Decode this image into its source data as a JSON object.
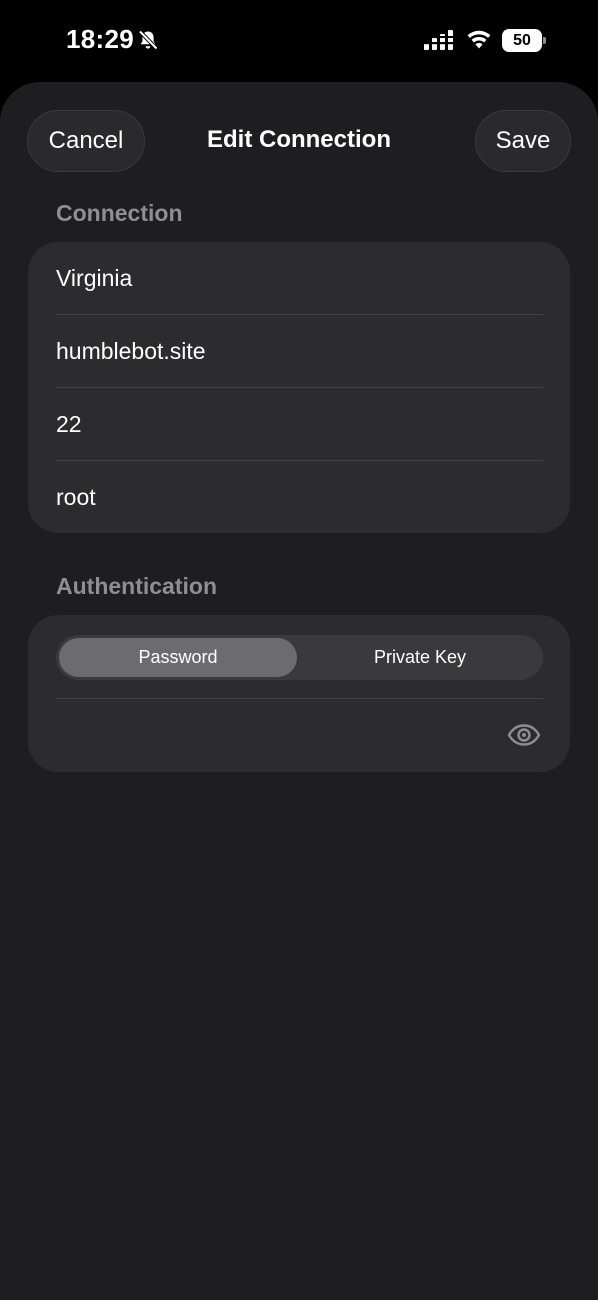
{
  "status_bar": {
    "time": "18:29",
    "battery": "50",
    "icons": [
      "bell-slash-icon",
      "cellular-signal-icon",
      "wifi-icon",
      "battery-icon"
    ]
  },
  "nav": {
    "cancel_label": "Cancel",
    "title": "Edit Connection",
    "save_label": "Save"
  },
  "connection": {
    "header": "Connection",
    "fields": {
      "name": "Virginia",
      "host": "humblebot.site",
      "port": "22",
      "username": "root"
    }
  },
  "authentication": {
    "header": "Authentication",
    "segments": [
      "Password",
      "Private Key"
    ],
    "selected": "Password",
    "password_value": "",
    "reveal_icon": "eye-icon"
  },
  "colors": {
    "background": "#000000",
    "sheet": "#1e1e20",
    "card": "#2c2c2e",
    "secondary_text": "#8e8e93",
    "segment_active": "#6c6c70"
  }
}
